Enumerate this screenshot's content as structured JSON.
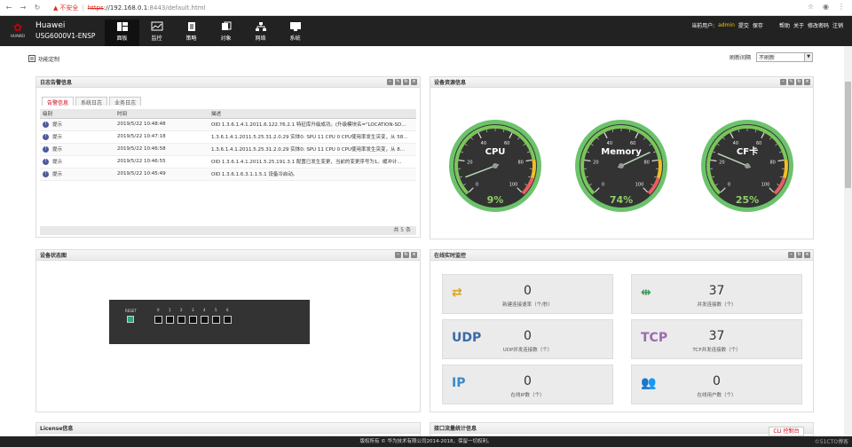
{
  "browser": {
    "warning_icon": "warning-triangle-icon",
    "not_secure": "不安全",
    "sep": "|",
    "scheme": "https",
    "host": "://192.168.0.1",
    "path": ":8443/default.html"
  },
  "app": {
    "logo_text": "HUAWEI",
    "brand": "Huawei",
    "model": "USG6000V1-ENSP"
  },
  "menu": [
    {
      "label": "面板",
      "icon": "dashboard-icon"
    },
    {
      "label": "监控",
      "icon": "monitor-icon"
    },
    {
      "label": "策略",
      "icon": "policy-icon"
    },
    {
      "label": "对象",
      "icon": "object-icon"
    },
    {
      "label": "网络",
      "icon": "network-icon"
    },
    {
      "label": "系统",
      "icon": "system-icon"
    }
  ],
  "user": {
    "label": "当前用户:",
    "name": "admin",
    "commit": "提交",
    "save": "保存",
    "help": "帮助",
    "about": "关于",
    "change_pwd": "修改密码",
    "logout": "注销"
  },
  "toolbar": {
    "custom": "功能定制",
    "refresh_label": "刷新间隔",
    "refresh_value": "不刷新"
  },
  "log_panel": {
    "title": "日志告警信息",
    "tabs": [
      "告警信息",
      "系统日志",
      "业务日志"
    ],
    "columns": [
      "级别",
      "时间",
      "描述"
    ],
    "rows": [
      {
        "level": "提示",
        "time": "2019/5/22 10:48:48",
        "desc": "OID 1.3.6.1.4.1.2011.6.122.76.2.1 特征库升级成功。(升级模块名=\"LOCATION-SD..."
      },
      {
        "level": "提示",
        "time": "2019/5/22 10:47:18",
        "desc": "1.3.6.1.4.1.2011.5.25.31.2.0.29 实体0: SPU 11 CPU 0 CPU使用率发生突变，从 58..."
      },
      {
        "level": "提示",
        "time": "2019/5/22 10:46:58",
        "desc": "1.3.6.1.4.1.2011.5.25.31.2.0.29 实体0: SPU 11 CPU 0 CPU使用率发生突变，从 8..."
      },
      {
        "level": "提示",
        "time": "2019/5/22 10:46:55",
        "desc": "OID 1.3.6.1.4.1.2011.5.25.191.3.1 配置已发生变更，当前的变更序号为1。缓冲计..."
      },
      {
        "level": "提示",
        "time": "2019/5/22 10:45:49",
        "desc": "OID 1.3.6.1.6.3.1.1.5.1 设备冷启动。"
      }
    ],
    "footer": "共 5 条"
  },
  "resource_panel": {
    "title": "设备资源信息",
    "gauges": [
      {
        "name": "CPU",
        "value": 9,
        "display": "9%"
      },
      {
        "name": "Memory",
        "value": 74,
        "display": "74%"
      },
      {
        "name": "CF卡",
        "value": 25,
        "display": "25%"
      }
    ],
    "ticks": [
      "0",
      "20",
      "40",
      "60",
      "80",
      "100"
    ]
  },
  "device_panel": {
    "title": "设备状态图",
    "reset_label": "RESET",
    "ports": [
      "0",
      "1",
      "2",
      "3",
      "4",
      "5",
      "6"
    ]
  },
  "online_panel": {
    "title": "在线实时监控",
    "cards": [
      {
        "icon": "shuffle-icon",
        "icon_text": "⇄",
        "num": "0",
        "label": "新建连接速率（个/秒）",
        "color": "#d4a520"
      },
      {
        "icon": "concurrent-icon",
        "icon_text": "⇹",
        "num": "37",
        "label": "并发连接数（个）",
        "color": "#3a9a5a"
      },
      {
        "icon": "udp-icon",
        "icon_text": "UDP",
        "num": "0",
        "label": "UDP并发连接数（个）",
        "color": "#3a6aa8"
      },
      {
        "icon": "tcp-icon",
        "icon_text": "TCP",
        "num": "37",
        "label": "TCP并发连接数（个）",
        "color": "#9a6ab0"
      },
      {
        "icon": "ip-icon",
        "icon_text": "IP",
        "num": "0",
        "label": "在线IP数（个）",
        "color": "#3a8ac8"
      },
      {
        "icon": "users-icon",
        "icon_text": "👥",
        "num": "0",
        "label": "在线用户数（个）",
        "color": "#c74040"
      }
    ]
  },
  "bottom": {
    "license": "License信息",
    "interface": "接口流量统计信息"
  },
  "footer": {
    "copyright": "版权所有 © 华为技术有限公司2014-2018，保留一切权利。",
    "cli": "CLI 控制台",
    "watermark": "©51CTO博客"
  }
}
